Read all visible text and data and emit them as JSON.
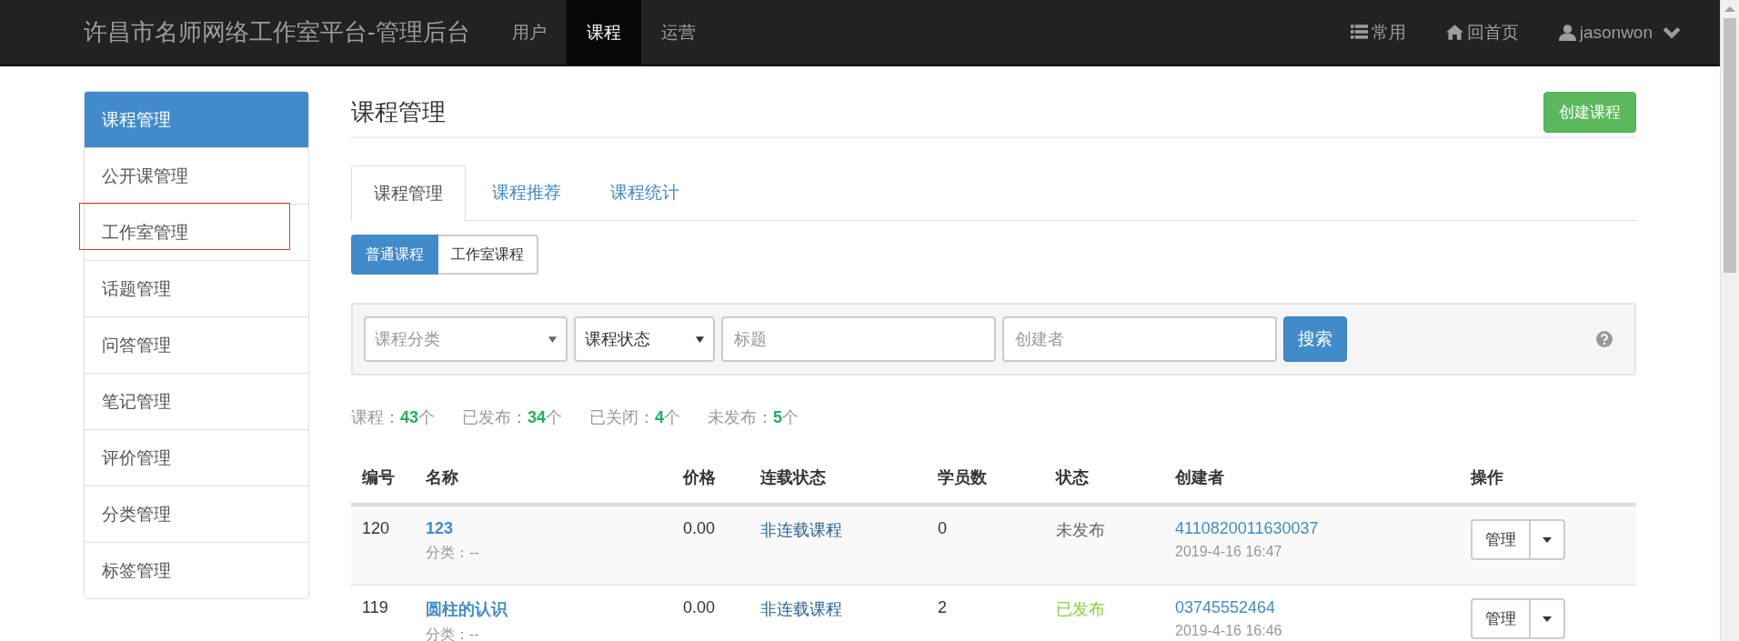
{
  "navbar": {
    "brand": "许昌市名师网络工作室平台-管理后台",
    "items": [
      {
        "label": "用户",
        "selected": false
      },
      {
        "label": "课程",
        "selected": true
      },
      {
        "label": "运营",
        "selected": false
      }
    ],
    "right_items": [
      {
        "kind": "list",
        "label": "常用"
      },
      {
        "kind": "home",
        "label": "回首页"
      },
      {
        "kind": "user",
        "label": "jasonwon"
      }
    ]
  },
  "sidebar": {
    "items": [
      {
        "label": "课程管理",
        "selected": true,
        "highlighted": false
      },
      {
        "label": "公开课管理",
        "selected": false,
        "highlighted": false
      },
      {
        "label": "工作室管理",
        "selected": false,
        "highlighted": true
      },
      {
        "label": "话题管理",
        "selected": false,
        "highlighted": false
      },
      {
        "label": "问答管理",
        "selected": false,
        "highlighted": false
      },
      {
        "label": "笔记管理",
        "selected": false,
        "highlighted": false
      },
      {
        "label": "评价管理",
        "selected": false,
        "highlighted": false
      },
      {
        "label": "分类管理",
        "selected": false,
        "highlighted": false
      },
      {
        "label": "标签管理",
        "selected": false,
        "highlighted": false
      }
    ]
  },
  "page_title": "课程管理",
  "create_button": "创建课程",
  "tabs": [
    {
      "label": "课程管理",
      "selected": true
    },
    {
      "label": "课程推荐",
      "selected": false
    },
    {
      "label": "课程统计",
      "selected": false
    }
  ],
  "type_buttons": [
    {
      "label": "普通课程",
      "selected": true
    },
    {
      "label": "工作室课程",
      "selected": false
    }
  ],
  "filters": {
    "category_select": "课程分类",
    "status_select": "课程状态",
    "title_placeholder": "标题",
    "creator_placeholder": "创建者",
    "search_button": "搜索"
  },
  "stats": [
    "课程：**43**个",
    "已发布：**34**个",
    "已关闭：**4**个",
    "未发布：**5**个"
  ],
  "table": {
    "columns": [
      "编号",
      "名称",
      "价格",
      "连载状态",
      "学员数",
      "状态",
      "创建者",
      "操作"
    ],
    "rows": [
      {
        "id": "120",
        "name": "123",
        "category": "分类：--",
        "price": "0.00",
        "serial": "非连载课程",
        "students": "0",
        "status": "未发布",
        "published": false,
        "creator": "4110820011630037",
        "created": "2019-4-16 16:47",
        "action": "管理"
      },
      {
        "id": "119",
        "name": "圆柱的认识",
        "category": "分类：--",
        "price": "0.00",
        "serial": "非连载课程",
        "students": "2",
        "status": "已发布",
        "published": true,
        "creator": "03745552464",
        "created": "2019-4-16 16:46",
        "action": "管理"
      }
    ]
  }
}
